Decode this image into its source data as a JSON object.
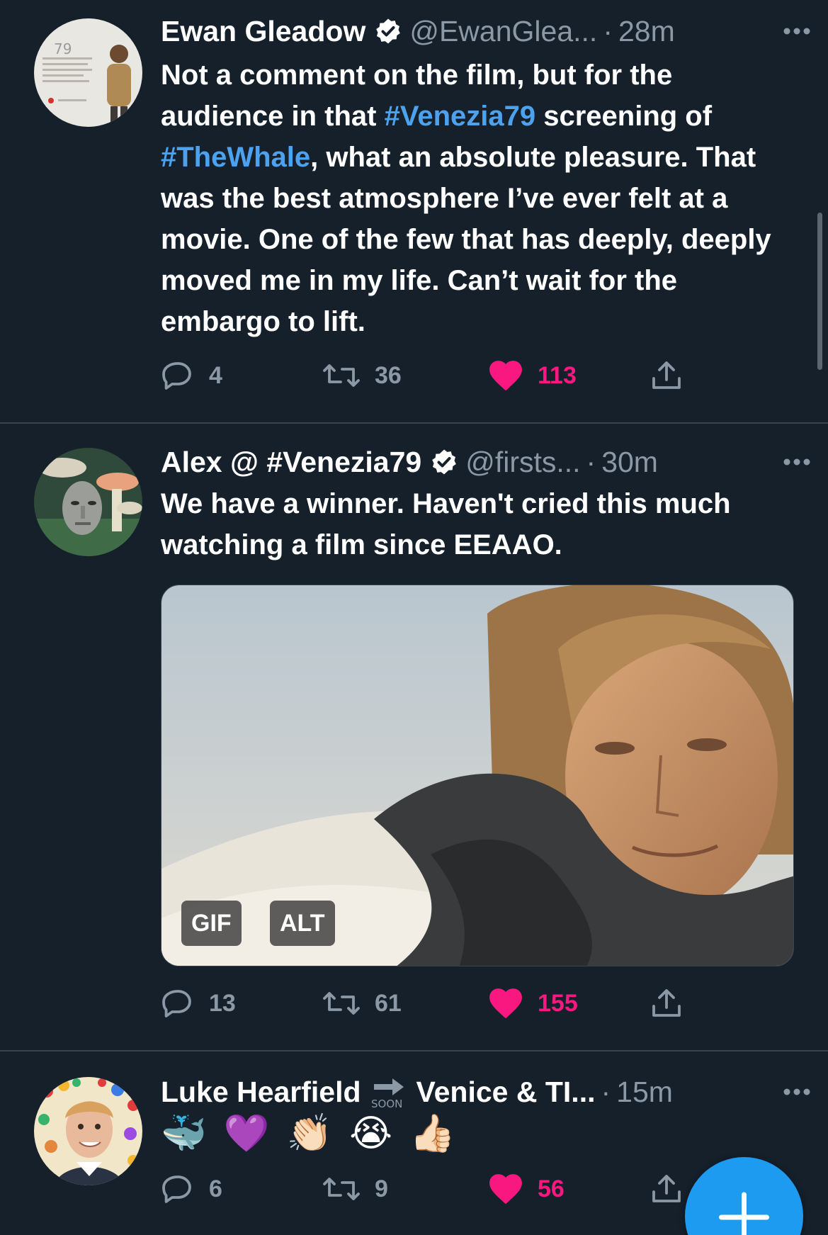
{
  "colors": {
    "background": "#15202b",
    "text": "#ffffff",
    "secondary": "#8b98a5",
    "link": "#4da2ef",
    "like": "#f91880",
    "divider": "#38444d",
    "fab": "#1d9bf0"
  },
  "tweets": [
    {
      "name": "Ewan Gleadow",
      "verified": true,
      "handle": "@EwanGlea...",
      "time": "28m",
      "body_parts": [
        {
          "text": "Not a comment on the film, but for the audience in that "
        },
        {
          "text": "#Venezia79",
          "hashtag": true
        },
        {
          "text": " screening of "
        },
        {
          "text": "#TheWhale",
          "hashtag": true
        },
        {
          "text": ", what an absolute pleasure. That was the best atmosphere I’ve ever felt at a movie. One of the few that has deeply, deeply moved me in my life. Can’t wait for the embargo to lift."
        }
      ],
      "replies": "4",
      "retweets": "36",
      "likes": "113",
      "liked": true
    },
    {
      "name": "Alex @ #Venezia79",
      "verified": true,
      "handle": "@firsts...",
      "time": "30m",
      "body_parts": [
        {
          "text": "We have a winner. Haven't cried this much watching a film since EEAAO."
        }
      ],
      "media": {
        "badges": [
          "GIF",
          "ALT"
        ]
      },
      "replies": "13",
      "retweets": "61",
      "likes": "155",
      "liked": true
    },
    {
      "name": "Luke Hearfield",
      "name_suffix": "Venice & TI...",
      "name_icon": "soon-arrow-icon",
      "handle": "",
      "time": "15m",
      "emojis": [
        "🐳",
        "💜",
        "👏🏻",
        "😭",
        "👍🏻"
      ],
      "replies": "6",
      "retweets": "9",
      "likes": "56",
      "liked": true
    }
  ],
  "fab": {
    "icon": "plus-icon",
    "label": "Compose"
  }
}
